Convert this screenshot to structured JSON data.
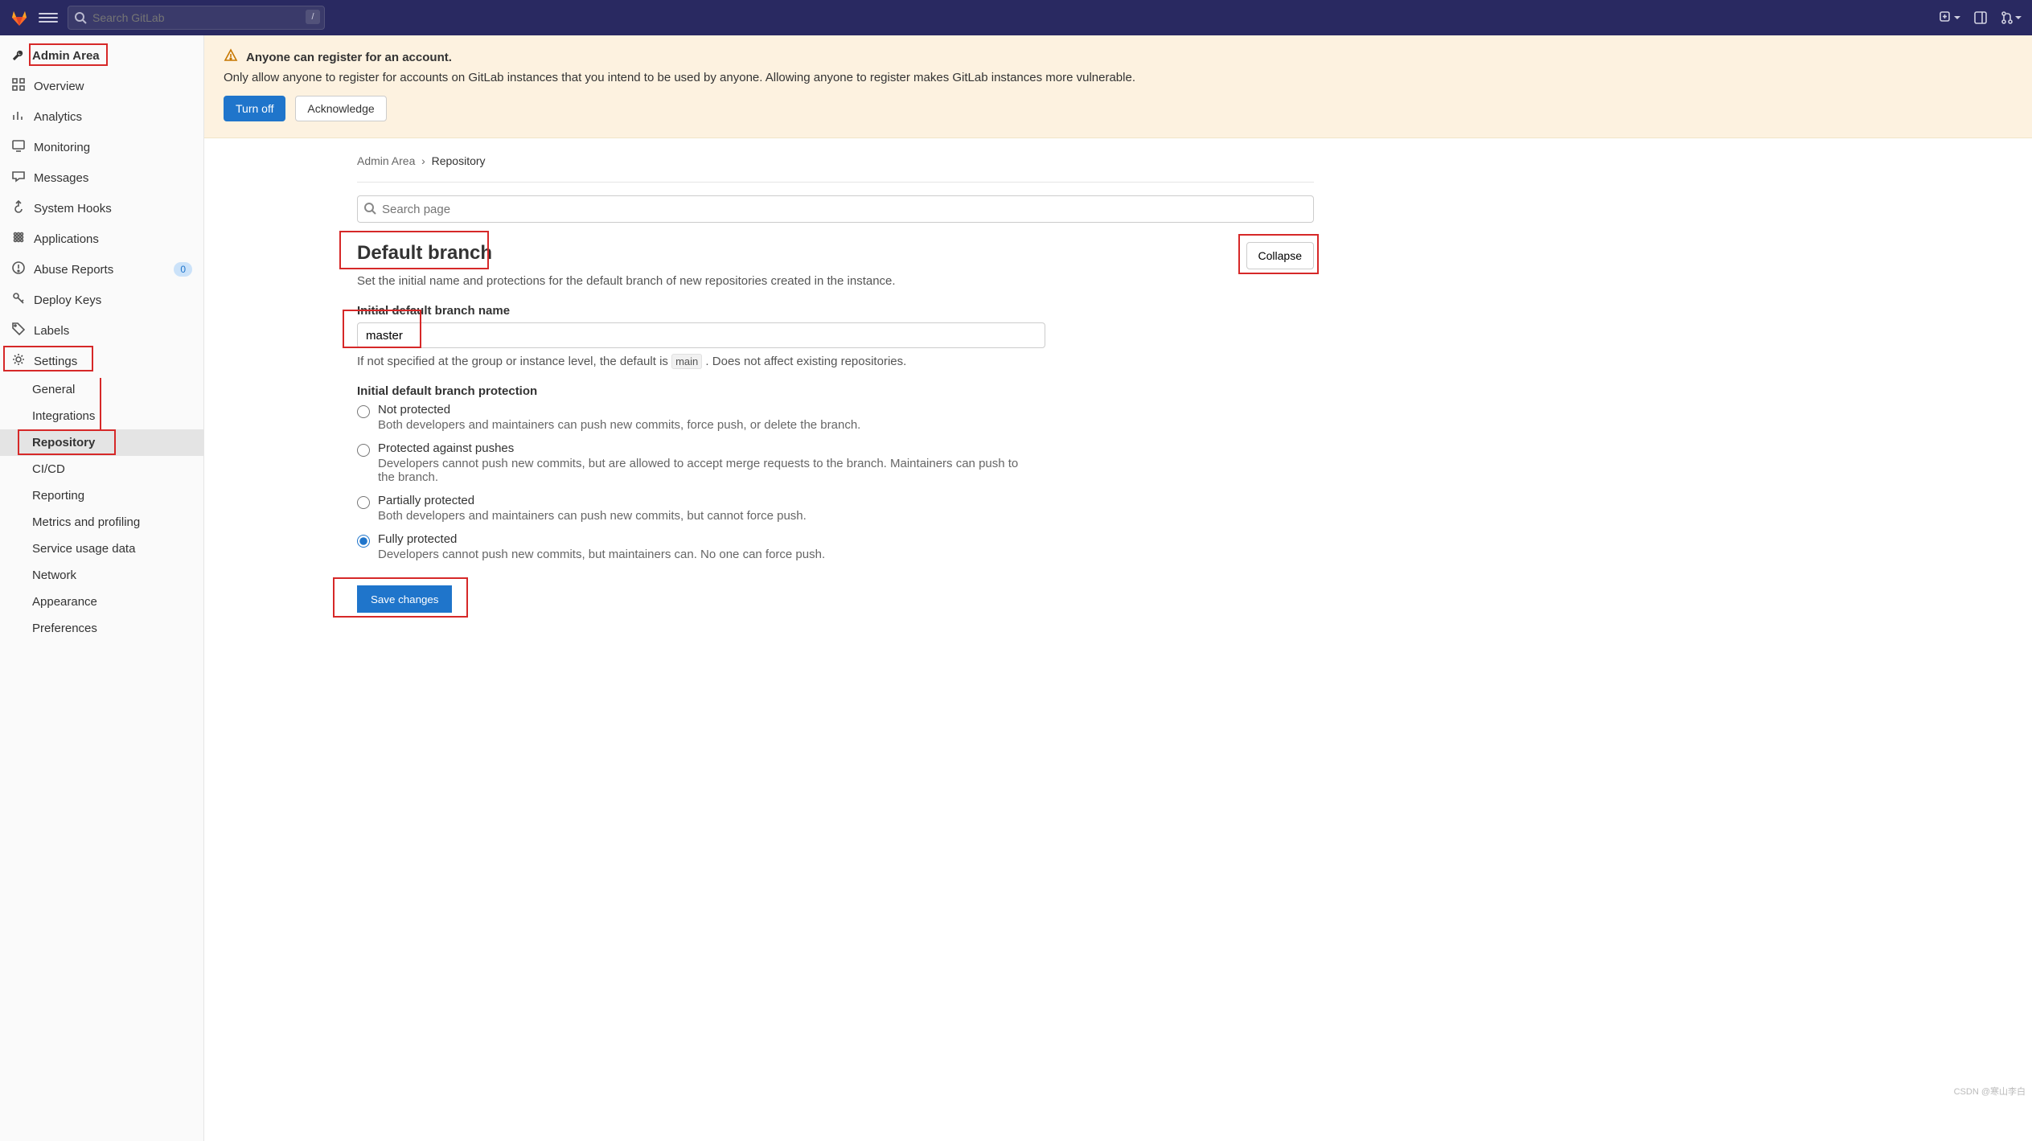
{
  "nav": {
    "search_placeholder": "Search GitLab",
    "kbd_hint": "/"
  },
  "sidebar": {
    "title": "Admin Area",
    "items": [
      {
        "icon": "dashboard",
        "label": "Overview"
      },
      {
        "icon": "analytics",
        "label": "Analytics"
      },
      {
        "icon": "monitoring",
        "label": "Monitoring"
      },
      {
        "icon": "messages",
        "label": "Messages"
      },
      {
        "icon": "hooks",
        "label": "System Hooks"
      },
      {
        "icon": "apps",
        "label": "Applications"
      },
      {
        "icon": "abuse",
        "label": "Abuse Reports",
        "badge": "0"
      },
      {
        "icon": "key",
        "label": "Deploy Keys"
      },
      {
        "icon": "labels",
        "label": "Labels"
      },
      {
        "icon": "gear",
        "label": "Settings"
      }
    ],
    "settings_children": [
      {
        "label": "General"
      },
      {
        "label": "Integrations"
      },
      {
        "label": "Repository",
        "active": true
      },
      {
        "label": "CI/CD"
      },
      {
        "label": "Reporting"
      },
      {
        "label": "Metrics and profiling"
      },
      {
        "label": "Service usage data"
      },
      {
        "label": "Network"
      },
      {
        "label": "Appearance"
      },
      {
        "label": "Preferences"
      }
    ]
  },
  "alert": {
    "title": "Anyone can register for an account.",
    "body": "Only allow anyone to register for accounts on GitLab instances that you intend to be used by anyone. Allowing anyone to register makes GitLab instances more vulnerable.",
    "turn_off": "Turn off",
    "ack": "Acknowledge"
  },
  "breadcrumbs": {
    "a": "Admin Area",
    "b": "Repository"
  },
  "page_search_placeholder": "Search page",
  "section": {
    "title": "Default branch",
    "desc": "Set the initial name and protections for the default branch of new repositories created in the instance.",
    "collapse": "Collapse",
    "field_label": "Initial default branch name",
    "field_value": "master",
    "help_pre": "If not specified at the group or instance level, the default is ",
    "help_code": "main",
    "help_post": " . Does not affect existing repositories.",
    "prot_label": "Initial default branch protection",
    "radios": [
      {
        "label": "Not protected",
        "desc": "Both developers and maintainers can push new commits, force push, or delete the branch."
      },
      {
        "label": "Protected against pushes",
        "desc": "Developers cannot push new commits, but are allowed to accept merge requests to the branch. Maintainers can push to the branch."
      },
      {
        "label": "Partially protected",
        "desc": "Both developers and maintainers can push new commits, but cannot force push."
      },
      {
        "label": "Fully protected",
        "desc": "Developers cannot push new commits, but maintainers can. No one can force push.",
        "selected": true
      }
    ],
    "save": "Save changes"
  },
  "watermark": "CSDN @寒山李白"
}
